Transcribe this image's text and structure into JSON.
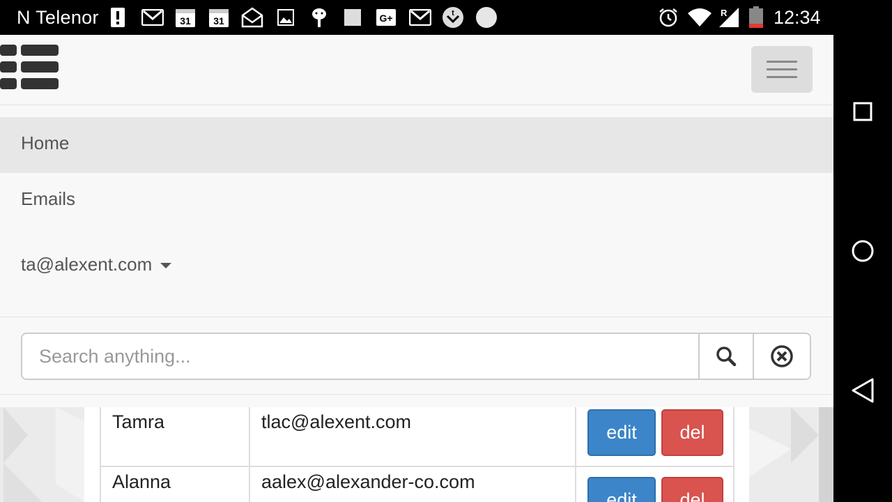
{
  "status_bar": {
    "carrier": "N Telenor",
    "time": "12:34",
    "calendar_day": "31",
    "notification_icons": [
      "alert-icon",
      "gmail-icon",
      "calendar-icon",
      "calendar-icon",
      "mail-open-icon",
      "image-icon",
      "android-icon",
      "square-icon",
      "google-plus-icon",
      "gmail-icon",
      "download-icon",
      "circle-icon"
    ],
    "system_icons": [
      "alarm-icon",
      "wifi-icon",
      "signal-icon",
      "battery-icon"
    ],
    "roaming_label": "R"
  },
  "navbar": {
    "buttons": [
      "recent-apps-icon",
      "home-icon",
      "back-icon"
    ]
  },
  "nav": {
    "home": "Home",
    "emails": "Emails",
    "user": "ta@alexent.com"
  },
  "search": {
    "placeholder": "Search anything...",
    "value": ""
  },
  "table": {
    "rows": [
      {
        "name": "Tamra",
        "email": "tlac@alexent.com",
        "edit_label": "edit",
        "del_label": "del"
      },
      {
        "name": "Alanna",
        "email": "aalex@alexander-co.com",
        "edit_label": "edit",
        "del_label": "del"
      }
    ]
  },
  "colors": {
    "edit": "#3c85c8",
    "delete": "#d9534f",
    "active_nav": "#e7e7e7"
  }
}
